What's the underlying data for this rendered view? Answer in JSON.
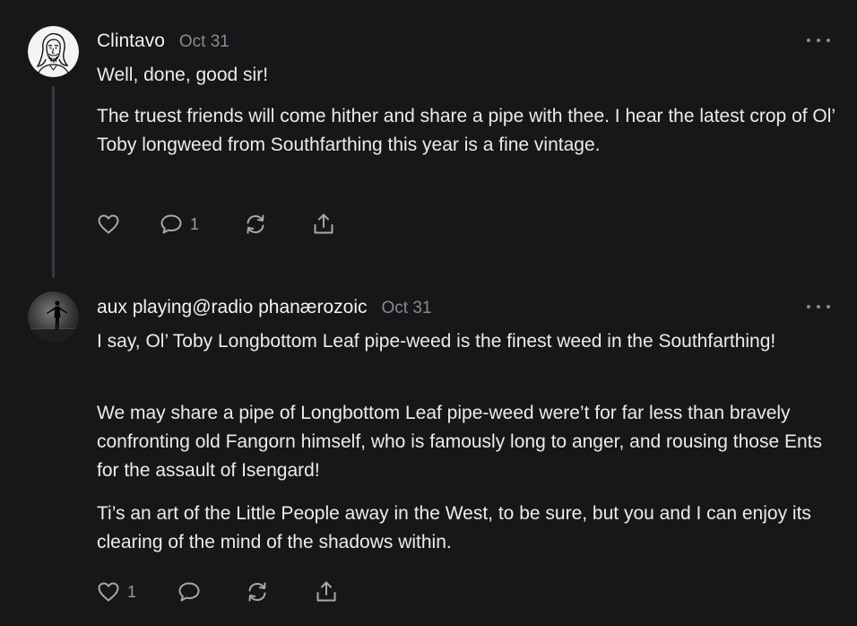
{
  "comments": [
    {
      "author": "Clintavo",
      "date": "Oct 31",
      "paragraphs": [
        "Well, done, good sir!",
        "The truest friends will come hither and share a pipe with thee. I hear the latest crop of Ol’ Toby longweed from Southfarthing this year is a fine vintage."
      ],
      "like_count": "",
      "reply_count": "1"
    },
    {
      "author": "aux playing@radio phanærozoic",
      "date": "Oct 31",
      "paragraphs": [
        "I say, Ol’ Toby Longbottom Leaf pipe-weed is the finest weed in the Southfarthing!",
        "We may share a pipe of Longbottom Leaf pipe-weed were’t for far less than bravely confronting old Fangorn himself, who is famously long to anger, and rousing those Ents for the assault of Isengard!",
        "Ti’s an art of the Little People away in the West, to be sure, but you and I can enjoy its clearing of the mind of the shadows within."
      ],
      "like_count": "1",
      "reply_count": ""
    }
  ],
  "icons": {
    "like": "heart-icon",
    "reply": "speech-bubble-icon",
    "restack": "refresh-arrows-icon",
    "share": "share-upload-icon",
    "more": "more-dots-icon"
  },
  "colors": {
    "background": "#17171a",
    "text": "#ececec",
    "muted": "#8a8a8e",
    "thread_line": "#3a3a3e"
  }
}
